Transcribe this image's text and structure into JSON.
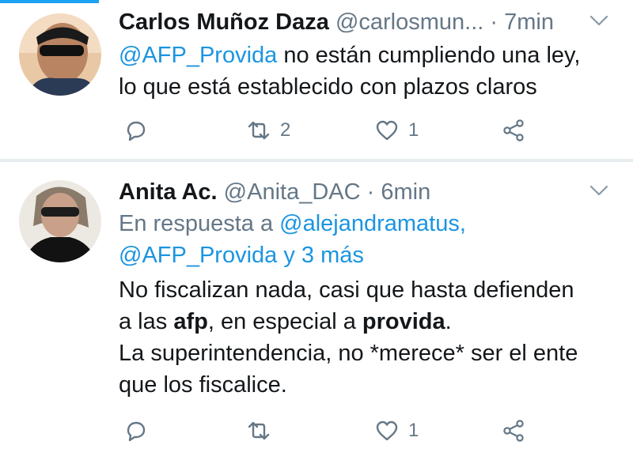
{
  "tweets": [
    {
      "name": "Carlos Muñoz Daza",
      "handle": "@carlosmun...",
      "dot": "·",
      "time": "7min",
      "body_mention": "@AFP_Provida",
      "body_line1_rest": " no están cumpliendo una ley,",
      "body_line2": "lo que está establecido con plazos claros",
      "retweets": "2",
      "likes": "1"
    },
    {
      "name": "Anita Ac.",
      "handle": "@Anita_DAC",
      "dot": "·",
      "time": "6min",
      "reply_prefix": "En respuesta a ",
      "reply_mention1": "@alejandramatus,",
      "reply_mention2": "@AFP_Provida",
      "reply_more": " y 3 más",
      "body_line1": "No fiscalizan nada, casi que hasta defienden",
      "body_line2_pre": "a las ",
      "body_line2_bold1": "afp",
      "body_line2_mid": ", en especial a ",
      "body_line2_bold2": "provida",
      "body_line2_end": ".",
      "body_line3": "La superintendencia, no *merece* ser el ente",
      "body_line4": "que los fiscalice.",
      "retweets": "",
      "likes": "1"
    }
  ],
  "colors": {
    "accent": "#1da1f2",
    "mention": "#1b95e0",
    "secondary_text": "#657786",
    "separator": "#e6ecf0"
  },
  "icons": {
    "reply": "reply-icon",
    "retweet": "retweet-icon",
    "like": "heart-icon",
    "share": "share-icon",
    "menu": "chevron-down-icon"
  }
}
